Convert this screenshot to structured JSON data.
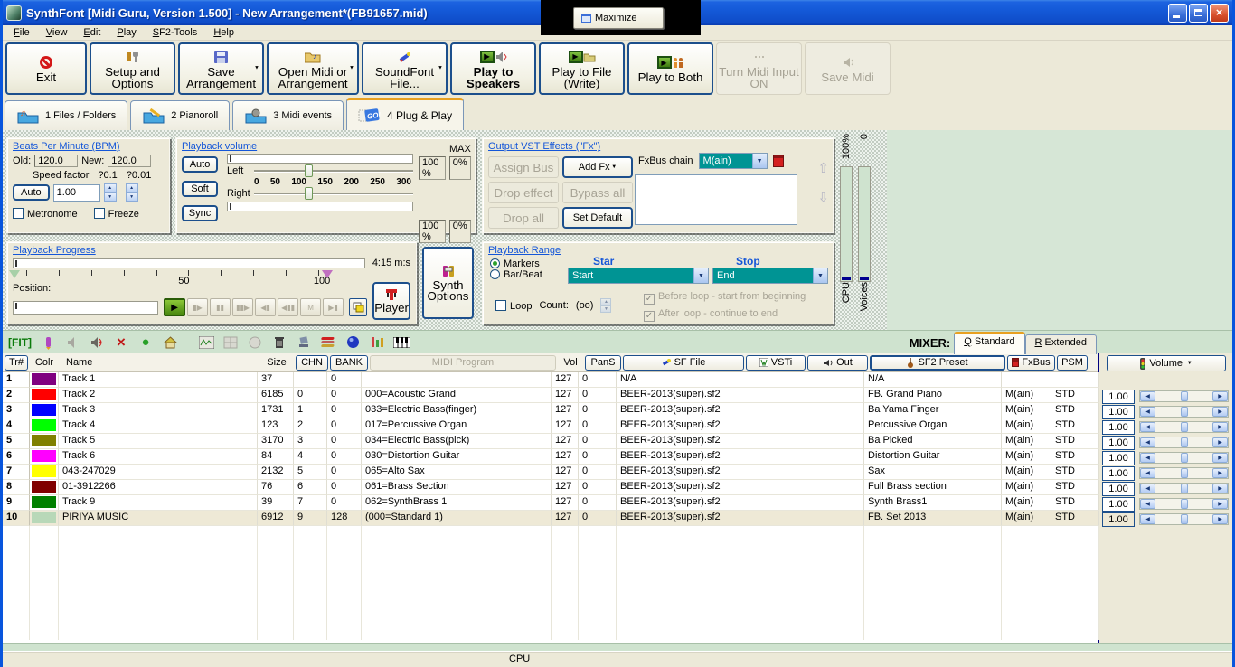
{
  "colors": {
    "titlebar": "#0855dd",
    "teal": "#009494",
    "button_border": "#1c4f8c",
    "panel": "#ece9d8",
    "grid_green": "#cfe3cf"
  },
  "window": {
    "title": "SynthFont [Midi Guru, Version 1.500] - New Arrangement*(FB91657.mid)"
  },
  "maximize_popup": {
    "label": "Maximize"
  },
  "menu": {
    "items": [
      "File",
      "View",
      "Edit",
      "Play",
      "SF2-Tools",
      "Help"
    ]
  },
  "toolbar": {
    "buttons": [
      {
        "label": "Exit"
      },
      {
        "label": "Setup and Options"
      },
      {
        "label": "Save Arrangement"
      },
      {
        "label": "Open Midi or Arrangement"
      },
      {
        "label": "SoundFont File..."
      },
      {
        "label": "Play to Speakers"
      },
      {
        "label": "Play to File (Write)"
      },
      {
        "label": "Play to Both"
      },
      {
        "label": "Turn Midi Input ON"
      },
      {
        "label": "Save Midi"
      }
    ]
  },
  "tabs": [
    {
      "label": "1 Files / Folders"
    },
    {
      "label": "2 Pianoroll"
    },
    {
      "label": "3 Midi events"
    },
    {
      "label": "4 Plug & Play"
    }
  ],
  "bpm": {
    "title": "Beats Per Minute (BPM)",
    "old_label": "Old:",
    "old_value": "120.0",
    "new_label": "New:",
    "new_value": "120.0",
    "speed_factor_label": "Speed factor",
    "step_01": "?0.1",
    "step_001": "?0.01",
    "auto_label": "Auto",
    "speed_value": "1.00",
    "metronome_label": "Metronome",
    "freeze_label": "Freeze"
  },
  "volume_panel": {
    "title": "Playback volume",
    "auto_label": "Auto",
    "soft_label": "Soft",
    "sync_label": "Sync",
    "left_label": "Left",
    "right_label": "Right",
    "scale": [
      "0",
      "50",
      "100",
      "150",
      "200",
      "250",
      "300"
    ],
    "left_percent": "100 %",
    "right_percent": "100 %",
    "max_label": "MAX",
    "left_max": "0%",
    "right_max": "0%"
  },
  "fx_panel": {
    "title": "Output VST Effects (\"Fx\")",
    "assign_bus": "Assign Bus",
    "add_fx": "Add Fx",
    "drop_effect": "Drop effect",
    "bypass_all": "Bypass all",
    "drop_all": "Drop all",
    "set_default": "Set Default",
    "fxbus_chain_label": "FxBus chain",
    "fxbus_value": "M(ain)",
    "up_glyph": "⇧",
    "down_glyph": "⇩"
  },
  "progress_panel": {
    "title": "Playback Progress",
    "time": "4:15 m:s",
    "ruler_mid": "50",
    "ruler_end": "100",
    "position_label": "Position:",
    "transport": [
      "▶",
      "▮▶",
      "▮▮",
      "▮▮▶",
      "◀▮",
      "◀▮▮",
      "M",
      "▶▮"
    ],
    "player_label": "Player"
  },
  "synth_options_label": "Synth Options",
  "range_panel": {
    "title": "Playback Range",
    "markers_label": "Markers",
    "barbeat_label": "Bar/Beat",
    "start_header": "Star",
    "stop_header": "Stop",
    "start_value": "Start",
    "stop_value": "End",
    "loop_label": "Loop",
    "count_label": "Count:",
    "count_value": "(oo)",
    "before_loop_label": "Before loop - start from beginning",
    "after_loop_label": "After loop - continue to end",
    "check_glyph": "✓"
  },
  "meters": {
    "cpu_top": "100%",
    "cpu_label": "CPU",
    "voices_top": "0",
    "voices_label": "Voices"
  },
  "mixer_bar": {
    "fit_label": "[FIT]",
    "mixer_label": "MIXER:",
    "standard_key": "Q",
    "standard_label": " Standard",
    "extended_key": "R",
    "extended_label": " Extended"
  },
  "table": {
    "columns": {
      "tr": "Tr#",
      "colr": "Colr",
      "name": "Name",
      "size": "Size",
      "chn": "CHN",
      "bank": "BANK",
      "program": "MIDI Program",
      "vol": "Vol",
      "pans": "PanS",
      "sffile": "SF File",
      "vsti": "VSTi",
      "out": "Out",
      "sf2preset": "SF2 Preset",
      "fxbus": "FxBus",
      "psm": "PSM"
    },
    "rows": [
      {
        "tr": "1",
        "color": "#800080",
        "name": "Track 1",
        "size": "37",
        "chn": "",
        "bank": "0",
        "program": "",
        "vol": "127",
        "pans": "0",
        "sffile": "N/A",
        "sf2preset": "N/A",
        "fxbus": "",
        "psm": ""
      },
      {
        "tr": "2",
        "color": "#ff0000",
        "name": "Track 2",
        "size": "6185",
        "chn": "0",
        "bank": "0",
        "program": "000=Acoustic Grand",
        "vol": "127",
        "pans": "0",
        "sffile": "BEER-2013(super).sf2",
        "sf2preset": "FB. Grand Piano",
        "fxbus": "M(ain)",
        "psm": "STD"
      },
      {
        "tr": "3",
        "color": "#0000ff",
        "name": "Track 3",
        "size": "1731",
        "chn": "1",
        "bank": "0",
        "program": "033=Electric Bass(finger)",
        "vol": "127",
        "pans": "0",
        "sffile": "BEER-2013(super).sf2",
        "sf2preset": "Ba Yama Finger",
        "fxbus": "M(ain)",
        "psm": "STD"
      },
      {
        "tr": "4",
        "color": "#00ff00",
        "name": "Track 4",
        "size": "123",
        "chn": "2",
        "bank": "0",
        "program": "017=Percussive Organ",
        "vol": "127",
        "pans": "0",
        "sffile": "BEER-2013(super).sf2",
        "sf2preset": "Percussive Organ",
        "fxbus": "M(ain)",
        "psm": "STD"
      },
      {
        "tr": "5",
        "color": "#808000",
        "name": "Track 5",
        "size": "3170",
        "chn": "3",
        "bank": "0",
        "program": "034=Electric Bass(pick)",
        "vol": "127",
        "pans": "0",
        "sffile": "BEER-2013(super).sf2",
        "sf2preset": "Ba Picked",
        "fxbus": "M(ain)",
        "psm": "STD"
      },
      {
        "tr": "6",
        "color": "#ff00ff",
        "name": "Track 6",
        "size": "84",
        "chn": "4",
        "bank": "0",
        "program": "030=Distortion Guitar",
        "vol": "127",
        "pans": "0",
        "sffile": "BEER-2013(super).sf2",
        "sf2preset": "Distortion Guitar",
        "fxbus": "M(ain)",
        "psm": "STD"
      },
      {
        "tr": "7",
        "color": "#ffff00",
        "name": "043-247029",
        "size": "2132",
        "chn": "5",
        "bank": "0",
        "program": "065=Alto Sax",
        "vol": "127",
        "pans": "0",
        "sffile": "BEER-2013(super).sf2",
        "sf2preset": "Sax",
        "fxbus": "M(ain)",
        "psm": "STD"
      },
      {
        "tr": "8",
        "color": "#800000",
        "name": "01-3912266",
        "size": "76",
        "chn": "6",
        "bank": "0",
        "program": "061=Brass Section",
        "vol": "127",
        "pans": "0",
        "sffile": "BEER-2013(super).sf2",
        "sf2preset": "Full Brass section",
        "fxbus": "M(ain)",
        "psm": "STD"
      },
      {
        "tr": "9",
        "color": "#008000",
        "name": "Track 9",
        "size": "39",
        "chn": "7",
        "bank": "0",
        "program": "062=SynthBrass 1",
        "vol": "127",
        "pans": "0",
        "sffile": "BEER-2013(super).sf2",
        "sf2preset": "Synth Brass1",
        "fxbus": "M(ain)",
        "psm": "STD"
      },
      {
        "tr": "10",
        "color": "#b8d8b8",
        "name": "PIRIYA MUSIC",
        "size": "6912",
        "chn": "9",
        "bank": "128",
        "program": "(000=Standard 1)",
        "vol": "127",
        "pans": "0",
        "sffile": "BEER-2013(super).sf2",
        "sf2preset": "FB. Set 2013",
        "fxbus": "M(ain)",
        "psm": "STD"
      }
    ]
  },
  "mixer": {
    "volume_header": "Volume",
    "rows": [
      {
        "value": "1.00"
      },
      {
        "value": "1.00"
      },
      {
        "value": "1.00"
      },
      {
        "value": "1.00"
      },
      {
        "value": "1.00"
      },
      {
        "value": "1.00"
      },
      {
        "value": "1.00"
      },
      {
        "value": "1.00"
      },
      {
        "value": "1.00"
      }
    ]
  },
  "statusbar": {
    "cpu": "CPU"
  }
}
